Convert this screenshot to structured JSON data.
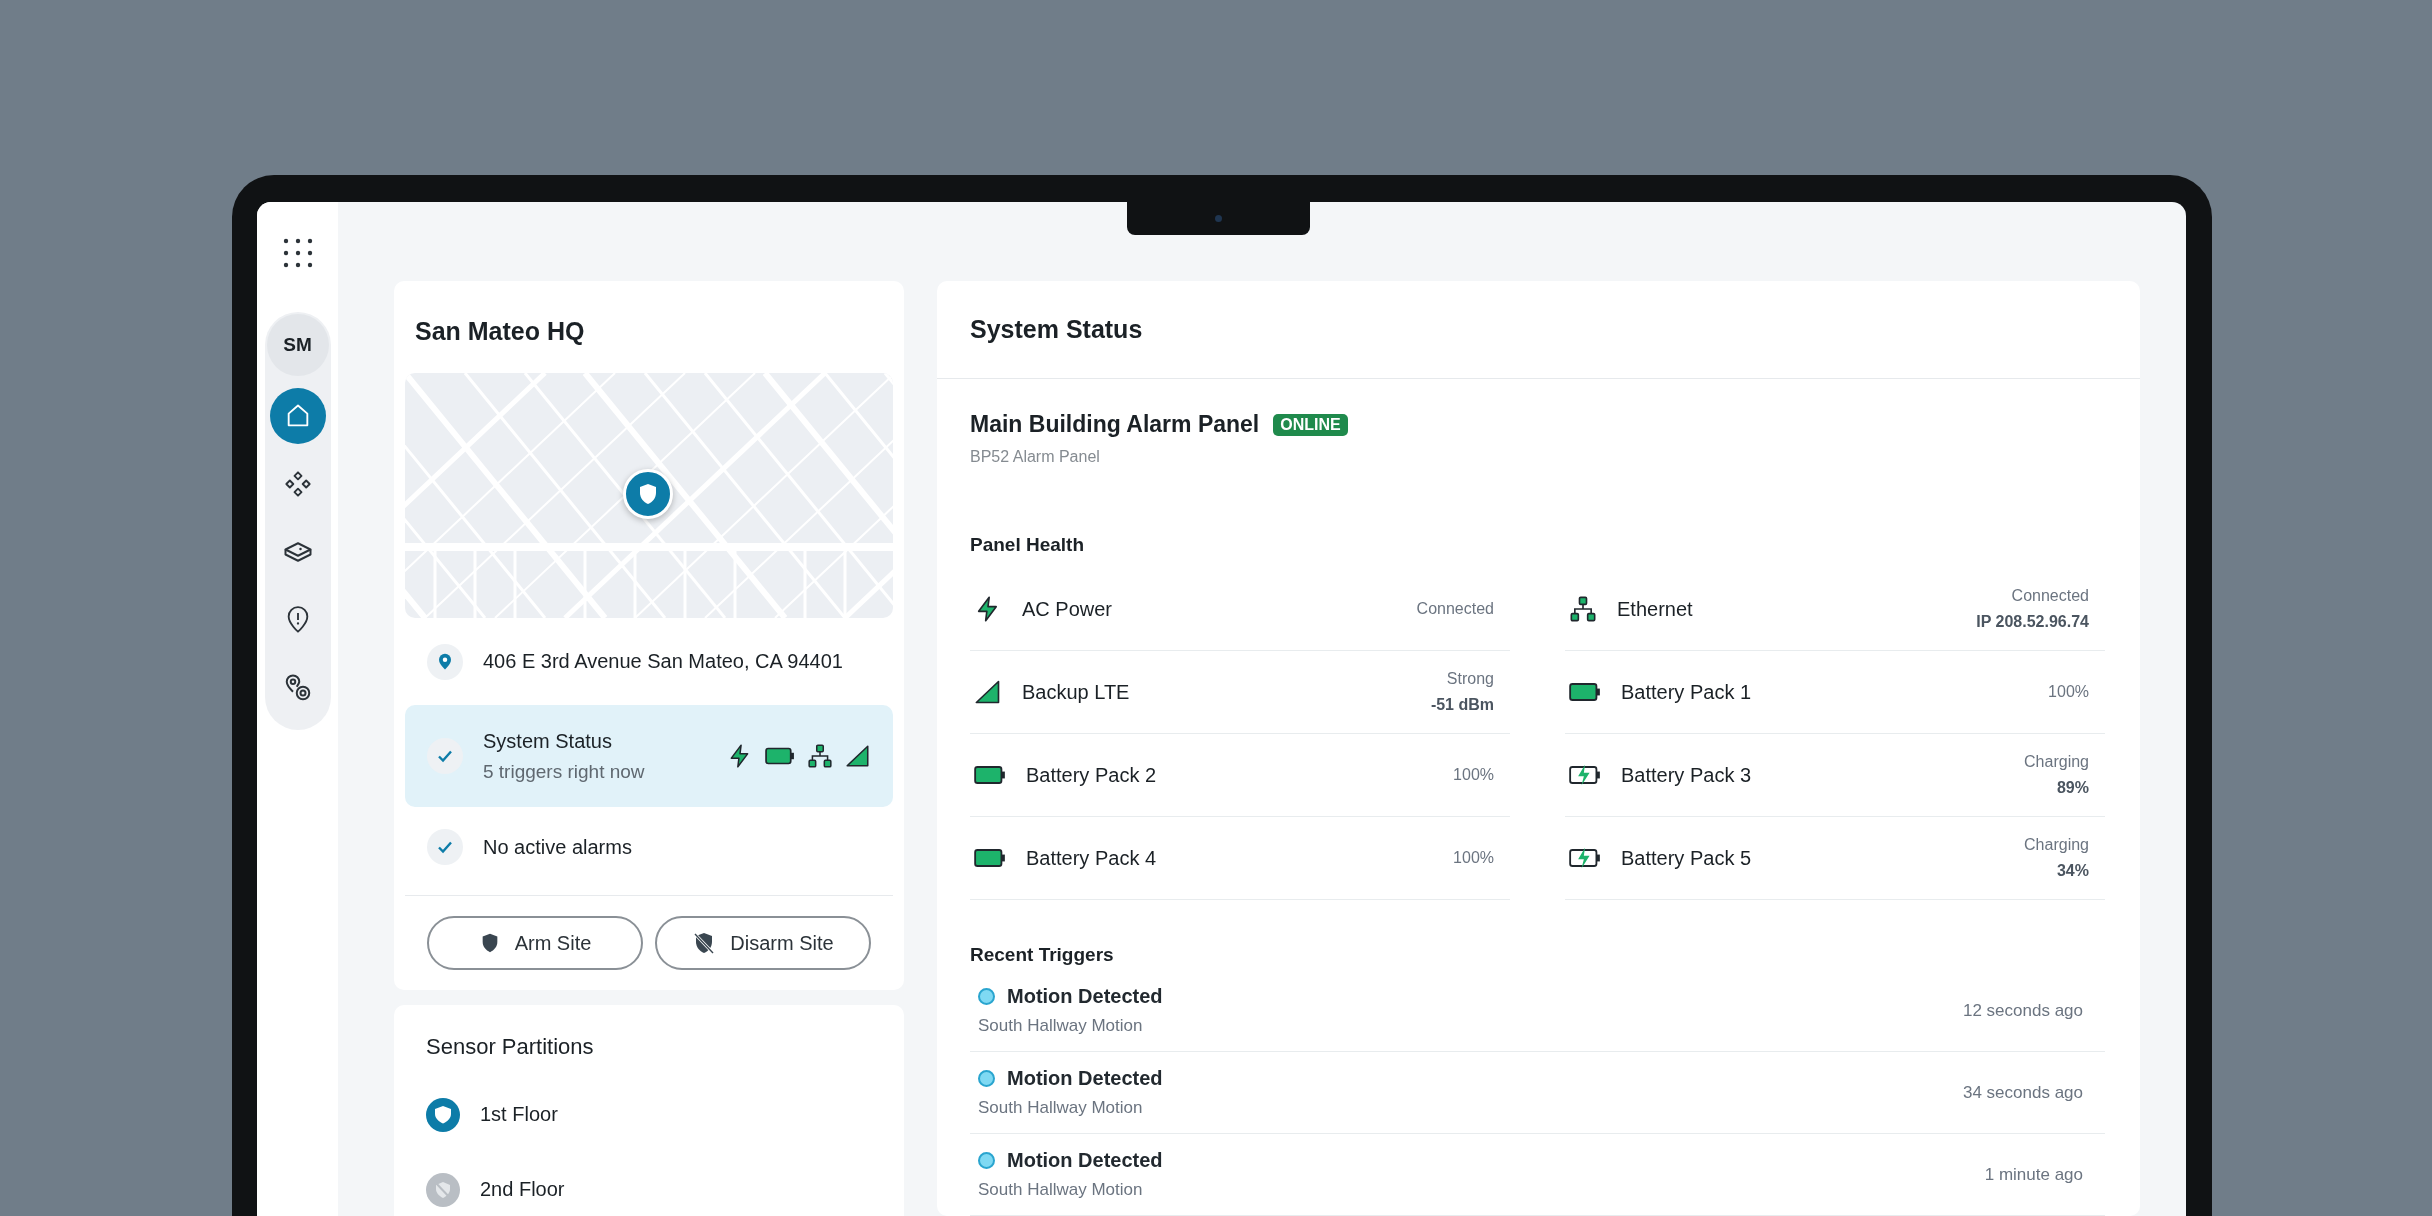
{
  "sidebar": {
    "avatar": "SM",
    "nav": [
      {
        "kind": "home",
        "selected": true
      },
      {
        "kind": "devices",
        "selected": false
      },
      {
        "kind": "hub",
        "selected": false
      },
      {
        "kind": "alerts",
        "selected": false
      },
      {
        "kind": "locations",
        "selected": false
      }
    ]
  },
  "site": {
    "title": "San Mateo HQ",
    "address": "406 E 3rd Avenue San Mateo, CA 94401",
    "status_items": [
      {
        "kind": "summary",
        "title": "System Status",
        "subtitle": "5 triggers right now",
        "selected": true
      },
      {
        "kind": "plain",
        "title": "No active alarms",
        "selected": false
      }
    ],
    "buttons": [
      {
        "kind": "arm",
        "label": "Arm Site"
      },
      {
        "kind": "disarm",
        "label": "Disarm Site"
      }
    ]
  },
  "partitions": {
    "title": "Sensor Partitions",
    "items": [
      {
        "name": "1st Floor",
        "armed": true
      },
      {
        "name": "2nd Floor",
        "armed": false
      }
    ]
  },
  "system_status": {
    "title": "System Status",
    "panel": {
      "name": "Main Building Alarm Panel",
      "badge": "ONLINE",
      "model": "BP52 Alarm Panel"
    },
    "health_title": "Panel Health",
    "health": [
      {
        "kind": "power",
        "name": "AC Power",
        "status": "Connected"
      },
      {
        "kind": "ethernet",
        "name": "Ethernet",
        "status": "Connected",
        "detail": "IP 208.52.96.74"
      },
      {
        "kind": "lte",
        "name": "Backup LTE",
        "status": "Strong",
        "detail": "-51 dBm"
      },
      {
        "kind": "battery",
        "name": "Battery Pack 1",
        "status": "100%"
      },
      {
        "kind": "battery",
        "name": "Battery Pack 2",
        "status": "100%"
      },
      {
        "kind": "charging",
        "name": "Battery Pack 3",
        "status": "Charging",
        "detail": "89%"
      },
      {
        "kind": "battery",
        "name": "Battery Pack 4",
        "status": "100%"
      },
      {
        "kind": "charging",
        "name": "Battery Pack 5",
        "status": "Charging",
        "detail": "34%"
      }
    ],
    "triggers_title": "Recent Triggers",
    "triggers": [
      {
        "title": "Motion Detected",
        "source": "South Hallway Motion",
        "time": "12 seconds ago"
      },
      {
        "title": "Motion Detected",
        "source": "South Hallway Motion",
        "time": "34 seconds ago"
      },
      {
        "title": "Motion Detected",
        "source": "South Hallway Motion",
        "time": "1 minute ago"
      }
    ]
  }
}
